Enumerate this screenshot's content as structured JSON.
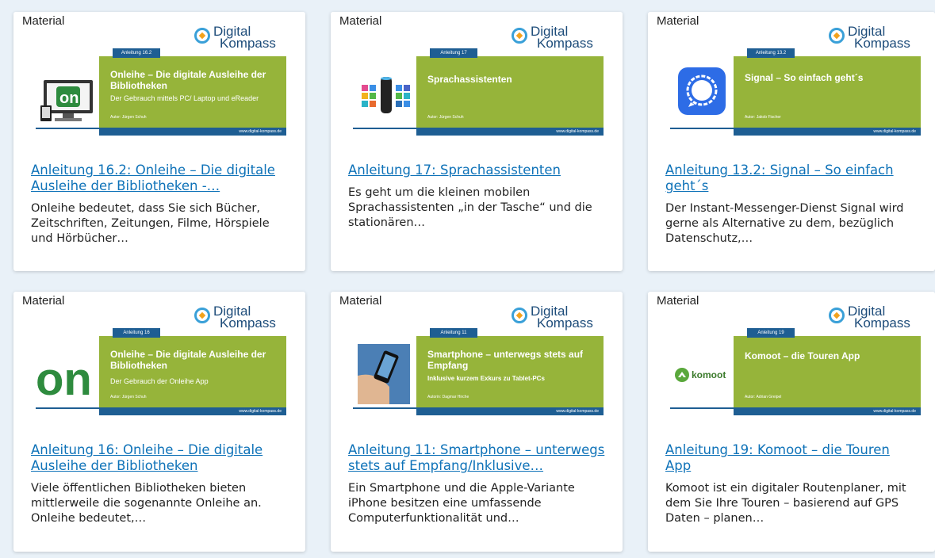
{
  "cards": [
    {
      "badge": "Material",
      "logo_line1": "Digital",
      "logo_line2": "Kompass",
      "tag": "Anleitung 16.2",
      "panel_title": "Onleihe – Die digitale Ausleihe der Bibliotheken",
      "panel_subtitle": "Der Gebrauch mittels PC/ Laptop und eReader",
      "panel_author": "Autor: Jürgen Schuh",
      "footer_url": "www.digital-kompass.de",
      "title": "Anleitung 16.2: Onleihe – Die digitale Ausleihe der Bibliotheken -…",
      "description": "Onleihe bedeutet, dass Sie sich Bücher, Zeitschriften, Zeitungen, Filme, Hörspiele und Hörbücher…"
    },
    {
      "badge": "Material",
      "logo_line1": "Digital",
      "logo_line2": "Kompass",
      "tag": "Anleitung 17",
      "panel_title": "Sprachassistenten",
      "panel_subtitle": "",
      "panel_author": "Autor: Jürgen Schuh",
      "footer_url": "www.digital-kompass.de",
      "title": "Anleitung 17: Sprachassistenten",
      "description": "Es geht um die kleinen mobilen Sprachassistenten „in der Tasche“ und die stationären…"
    },
    {
      "badge": "Material",
      "logo_line1": "Digital",
      "logo_line2": "Kompass",
      "tag": "Anleitung 13.2",
      "panel_title": "Signal – So einfach geht´s",
      "panel_subtitle": "",
      "panel_author": "Autor: Jakob Fischer",
      "footer_url": "www.digital-kompass.de",
      "title": "Anleitung 13.2: Signal – So einfach geht´s",
      "description": "Der Instant-Messenger-Dienst Signal wird gerne als Alternative zu dem, bezüglich Datenschutz,…"
    },
    {
      "badge": "Material",
      "logo_line1": "Digital",
      "logo_line2": "Kompass",
      "tag": "Anleitung 16",
      "panel_title": "Onleihe – Die digitale Ausleihe der Bibliotheken",
      "panel_subtitle": "Der Gebrauch der Onleihe App",
      "panel_author": "Autor: Jürgen Schuh",
      "footer_url": "www.digital-kompass.de",
      "title": "Anleitung 16: Onleihe – Die digitale Ausleihe der Bibliotheken",
      "description": "Viele öffentlichen Bibliotheken bieten mittlerweile die sogenannte Onleihe an. Onleihe bedeutet,…"
    },
    {
      "badge": "Material",
      "logo_line1": "Digital",
      "logo_line2": "Kompass",
      "tag": "Anleitung 11",
      "panel_title": "Smartphone – unterwegs stets auf Empfang",
      "panel_subtitle": "Inklusive kurzem Exkurs zu Tablet-PCs",
      "panel_author": "Autorin: Dagmar Hirche",
      "footer_url": "www.digital-kompass.de",
      "title": "Anleitung 11: Smartphone – unterwegs stets auf Empfang/Inklusive…",
      "description": "Ein Smartphone und die Apple-Variante iPhone besitzen eine umfassende Computerfunktionalität und…"
    },
    {
      "badge": "Material",
      "logo_line1": "Digital",
      "logo_line2": "Kompass",
      "tag": "Anleitung 19",
      "panel_title": "Komoot – die Touren App",
      "panel_subtitle": "",
      "panel_author": "Autor: Adrian Greipel",
      "footer_url": "www.digital-kompass.de",
      "title": "Anleitung 19: Komoot – die Touren App",
      "description": "Komoot ist ein digitaler Routenplaner, mit dem Sie Ihre Touren – basierend auf GPS Daten – planen…",
      "komoot_text": "komoot"
    }
  ],
  "colors": {
    "page_bg": "#e9f1f8",
    "panel_green": "#96b43a",
    "brand_blue": "#1e5e93",
    "link_blue": "#0e72b8"
  }
}
